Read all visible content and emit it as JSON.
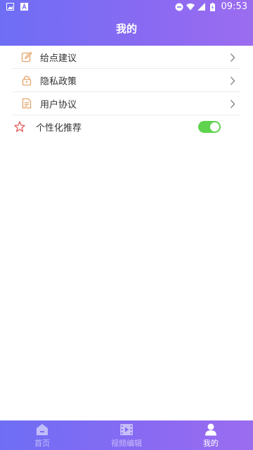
{
  "status_bar": {
    "time": "09:53",
    "icons": [
      "image-icon",
      "font-icon",
      "dnd-icon",
      "wifi-icon",
      "signal-icon",
      "battery-icon"
    ]
  },
  "header": {
    "title": "我的"
  },
  "menu": {
    "items": [
      {
        "label": "给点建议",
        "icon": "edit-icon"
      },
      {
        "label": "隐私政策",
        "icon": "lock-icon"
      },
      {
        "label": "用户协议",
        "icon": "document-icon"
      }
    ],
    "personalized": {
      "label": "个性化推荐",
      "icon": "star-icon",
      "enabled": true
    }
  },
  "tabbar": {
    "tabs": [
      {
        "label": "首页",
        "icon": "home-icon"
      },
      {
        "label": "视频编辑",
        "icon": "video-icon"
      },
      {
        "label": "我的",
        "icon": "user-icon",
        "active": true
      }
    ]
  },
  "colors": {
    "accent": "#7b6cf3",
    "toggle_on": "#5fd34d",
    "menu_icon": "#e6a46a",
    "star_icon": "#e25b5b"
  }
}
